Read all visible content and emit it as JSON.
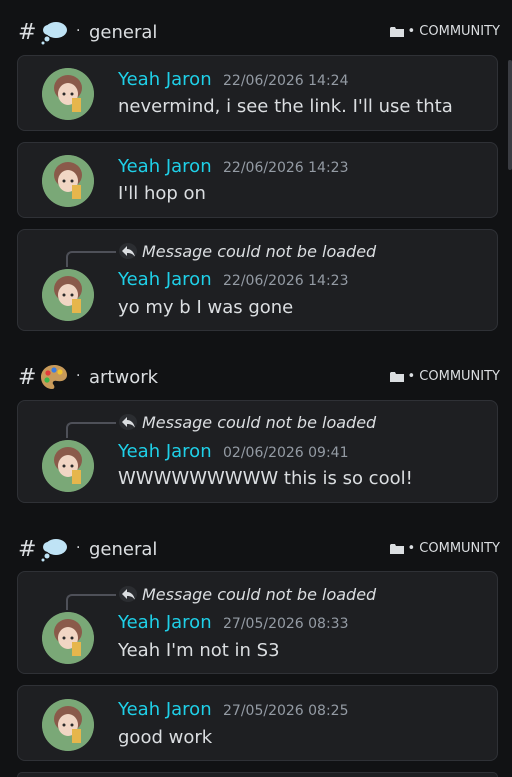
{
  "sections": [
    {
      "channel": "general",
      "emoji": "thought-balloon",
      "category": "• COMMUNITY",
      "messages": [
        {
          "author": "Yeah Jaron",
          "time": "22/06/2026 14:24",
          "content": "nevermind, i see the link. I'll use thta",
          "reply": null
        },
        {
          "author": "Yeah Jaron",
          "time": "22/06/2026 14:23",
          "content": "I'll hop on",
          "reply": null
        },
        {
          "author": "Yeah Jaron",
          "time": "22/06/2026 14:23",
          "content": "yo my b I was gone",
          "reply": "Message could not be loaded"
        }
      ]
    },
    {
      "channel": "artwork",
      "emoji": "artist-palette",
      "category": "• COMMUNITY",
      "messages": [
        {
          "author": "Yeah Jaron",
          "time": "02/06/2026 09:41",
          "content": "WWWWWWWWW this is so cool!",
          "reply": "Message could not be loaded"
        }
      ]
    },
    {
      "channel": "general",
      "emoji": "thought-balloon",
      "category": "• COMMUNITY",
      "messages": [
        {
          "author": "Yeah Jaron",
          "time": "27/05/2026 08:33",
          "content": "Yeah I'm not in S3",
          "reply": "Message could not be loaded"
        },
        {
          "author": "Yeah Jaron",
          "time": "27/05/2026 08:25",
          "content": "good work",
          "reply": null
        }
      ]
    }
  ],
  "header_hash": "#",
  "header_separator": "·",
  "colors": {
    "background": "#111214",
    "card": "#1e1f22",
    "author": "#1fd0e8",
    "timestamp": "#949ba4"
  }
}
